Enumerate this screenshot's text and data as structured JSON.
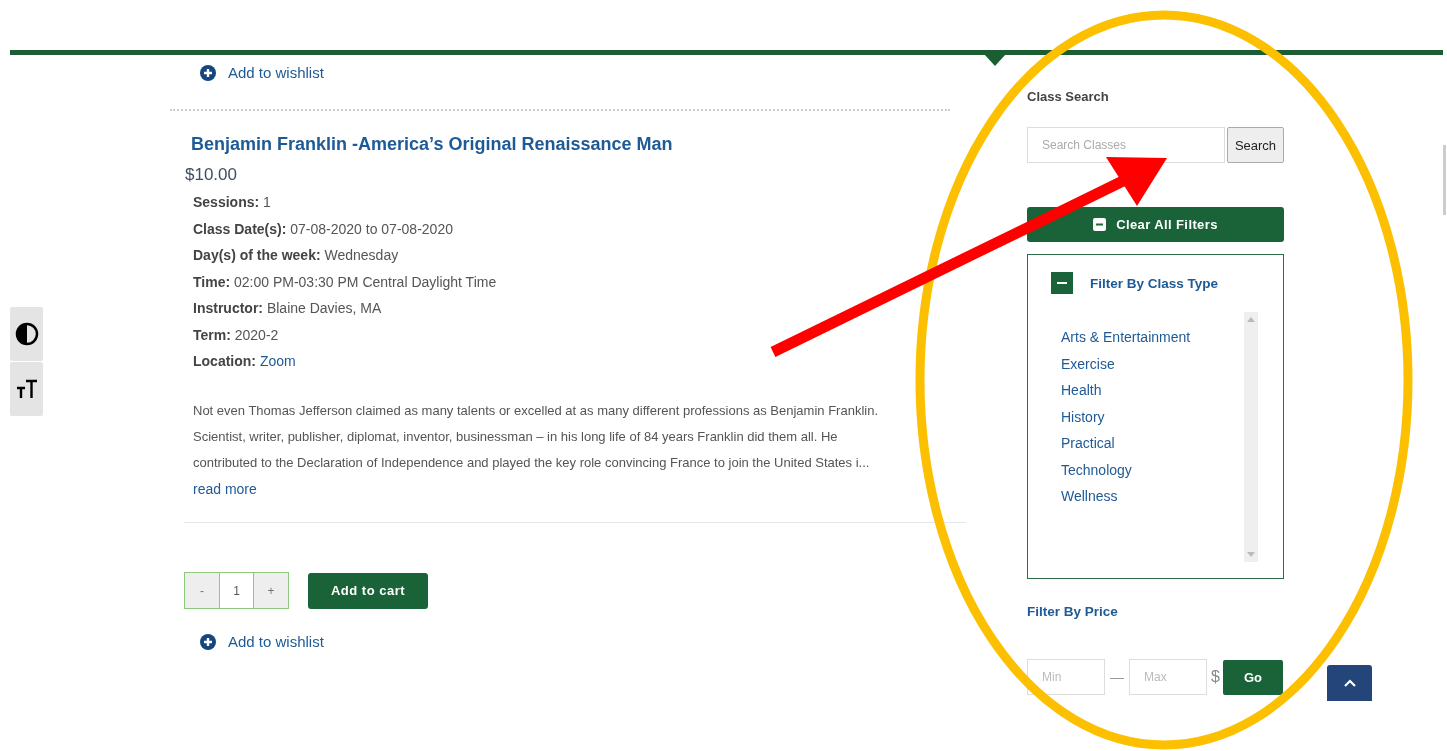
{
  "top_wishlist": {
    "label": "Add to wishlist"
  },
  "product": {
    "title": "Benjamin Franklin -America’s Original Renaissance Man",
    "price": "$10.00",
    "details": [
      {
        "label": "Sessions:",
        "value": "1",
        "kind": "text"
      },
      {
        "label": "Class Date(s):",
        "value": "07-08-2020 to 07-08-2020",
        "kind": "text"
      },
      {
        "label": "Day(s) of the week:",
        "value": "Wednesday",
        "kind": "text"
      },
      {
        "label": "Time:",
        "value": "02:00 PM-03:30 PM Central Daylight Time",
        "kind": "text"
      },
      {
        "label": "Instructor:",
        "value": "Blaine Davies, MA",
        "kind": "text"
      },
      {
        "label": "Term:",
        "value": "2020-2",
        "kind": "text"
      },
      {
        "label": "Location:",
        "value": "Zoom",
        "kind": "link"
      }
    ],
    "description": "Not even Thomas Jefferson claimed as many talents or excelled at as many different professions as Benjamin Franklin. Scientist, writer, publisher, diplomat, inventor, businessman – in his long life of 84 years Franklin did them all. He contributed to the Declaration of Independence and played the key role convincing France to join the United States i...",
    "read_more": "read more",
    "quantity": {
      "minus": "-",
      "value": "1",
      "plus": "+"
    },
    "add_to_cart": "Add to cart",
    "wishlist": "Add to wishlist"
  },
  "sidebar": {
    "search_heading": "Class Search",
    "search_placeholder": "Search Classes",
    "search_button": "Search",
    "clear_filters": "Clear All Filters",
    "class_type": {
      "heading": "Filter By Class Type",
      "expanded": true,
      "items": [
        "Arts & Entertainment",
        "Exercise",
        "Health",
        "History",
        "Practical",
        "Technology",
        "Wellness"
      ]
    },
    "price": {
      "heading": "Filter By Price",
      "min_placeholder": "Min",
      "separator": "—",
      "max_placeholder": "Max",
      "currency": "$",
      "go": "Go"
    }
  }
}
